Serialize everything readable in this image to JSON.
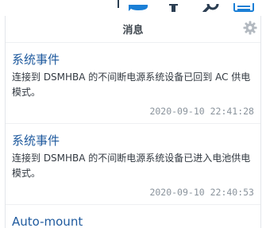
{
  "taskbar": {
    "icons": [
      "notification-bubble-icon",
      "user-icon",
      "search-icon",
      "widgets-icon"
    ],
    "accent": "#2b3e52",
    "bubble_color": "#1a7fd6"
  },
  "panel": {
    "title": "消息",
    "gear_icon": "gear-icon"
  },
  "notifications": [
    {
      "title": "系统事件",
      "body": "连接到 DSMHBA 的不间断电源系统设备已回到 AC 供电模式。",
      "time": "2020-09-10 22:41:28"
    },
    {
      "title": "系统事件",
      "body": "连接到 DSMHBA 的不间断电源系统设备已进入电池供电模式。",
      "time": "2020-09-10 22:40:53"
    },
    {
      "title": "Auto-mount",
      "body": "",
      "time": ""
    }
  ],
  "colors": {
    "title_blue": "#1f5a9e",
    "time_gray": "#8a939c",
    "header_text": "#404850"
  }
}
